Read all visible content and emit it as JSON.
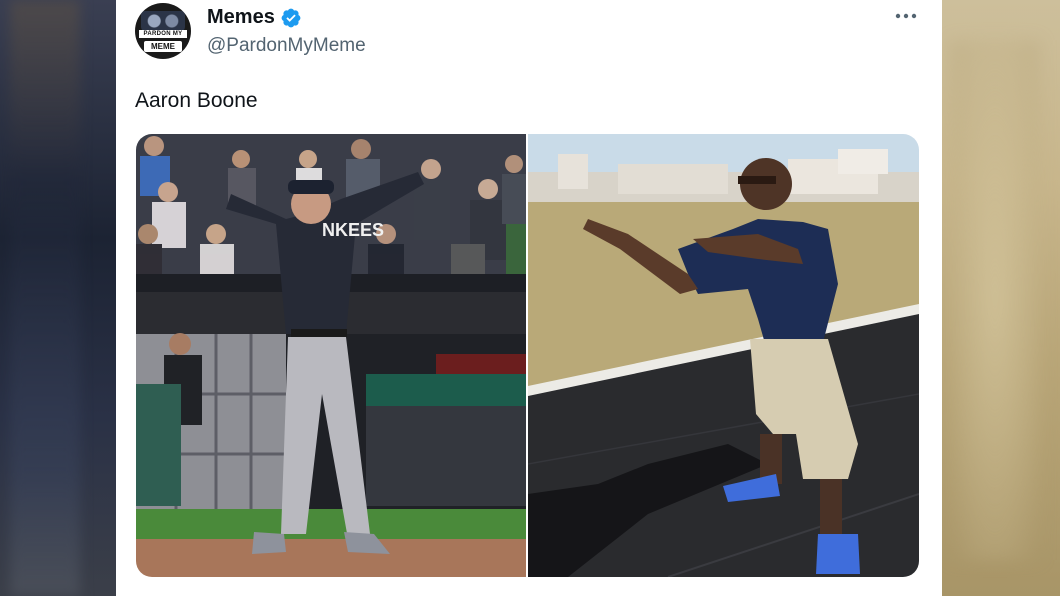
{
  "tweet": {
    "author_name": "Memes",
    "handle": "@PardonMyMeme",
    "verified": true,
    "text": "Aaron Boone",
    "more_icon": "more-horizontal-icon",
    "avatar": {
      "band_text": "PARDON MY",
      "badge_text": "MEME"
    },
    "media": [
      {
        "description_icon": "photo-baseball-manager",
        "jersey_text": "NKEES"
      },
      {
        "description_icon": "photo-boy-dancing-track"
      }
    ]
  },
  "colors": {
    "card_bg": "#ffffff",
    "name_color": "#0f1419",
    "handle_color": "#536471",
    "verified_blue": "#1d9bf0"
  }
}
